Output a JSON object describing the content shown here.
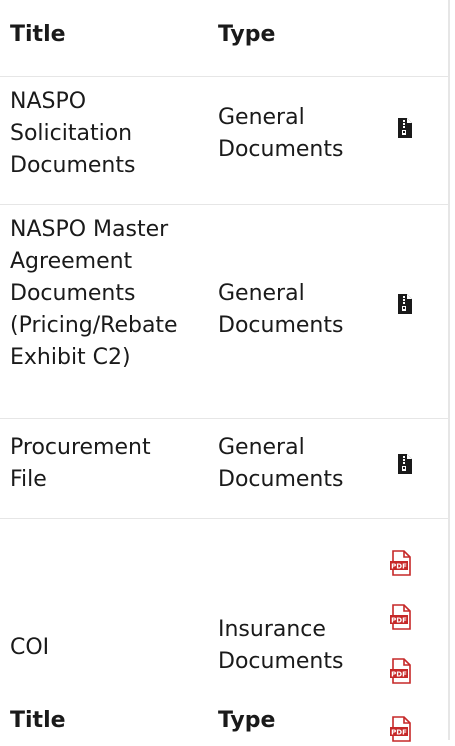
{
  "header": {
    "title_label": "Title",
    "type_label": "Type"
  },
  "rows": [
    {
      "title": "NASPO Solicitation Documents",
      "type": "General Documents",
      "icon": "zip-file-icon"
    },
    {
      "title": "NASPO Master Agreement Documents (Pricing/Rebate Exhibit C2)",
      "type": "General Documents",
      "icon": "zip-file-icon"
    },
    {
      "title": "Procurement File",
      "type": "General Documents",
      "icon": "zip-file-icon"
    },
    {
      "title": "COI",
      "type": "Insurance Documents",
      "icon": "pdf-file-icon"
    }
  ],
  "pdf_label": "PDF",
  "footer_header": {
    "title_label": "Title",
    "type_label": "Type"
  },
  "colors": {
    "pdf_red": "#c62828",
    "border": "#e6e6e6",
    "text": "#1a1a1a"
  }
}
